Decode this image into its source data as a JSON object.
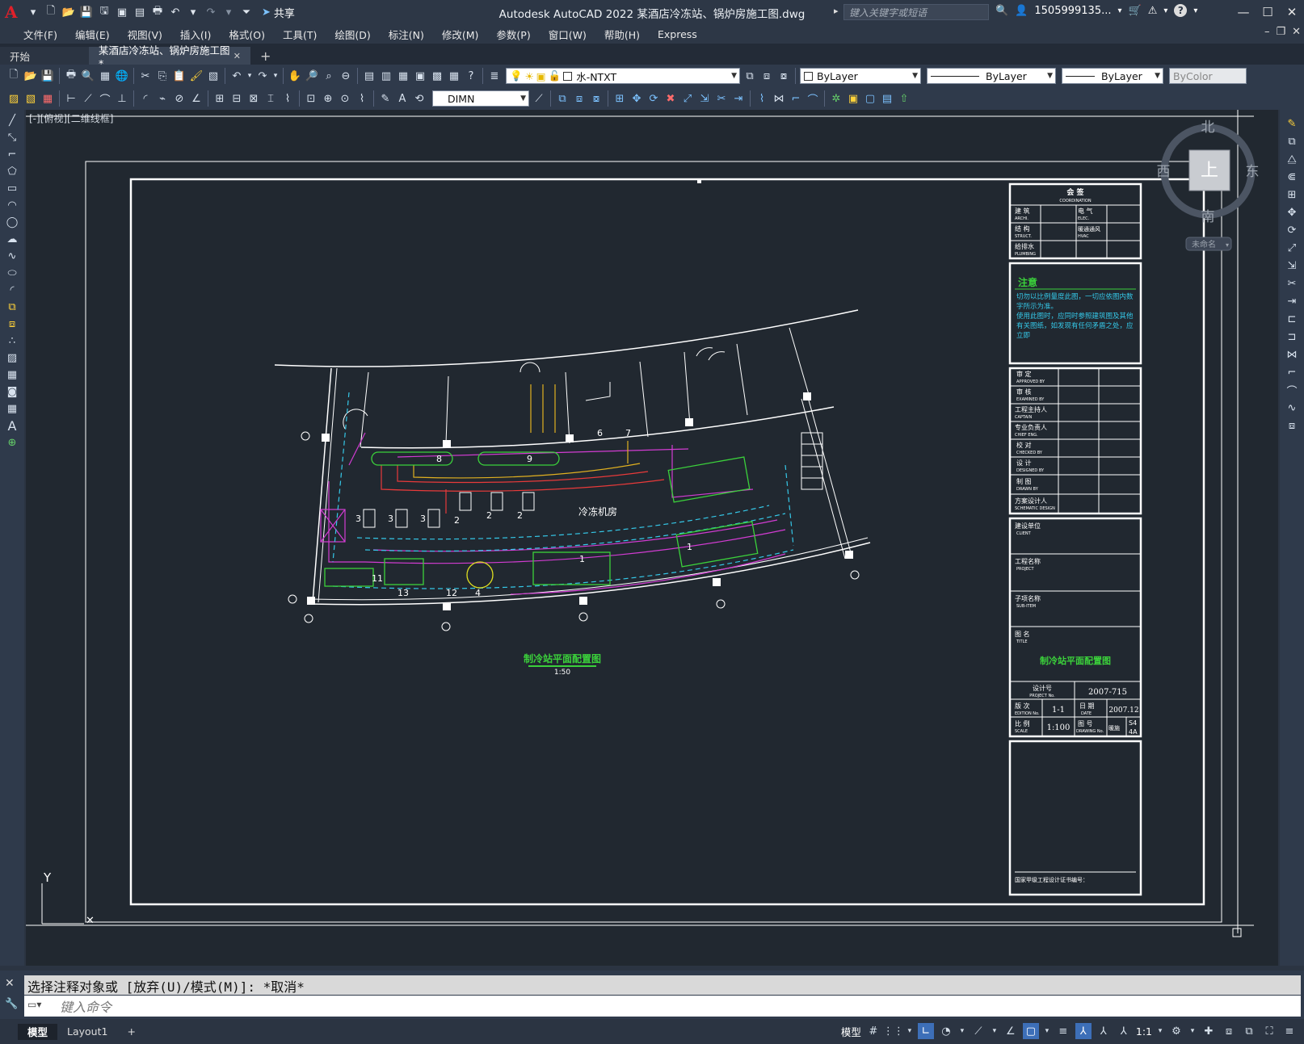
{
  "app": {
    "logo": "A",
    "window_title": "Autodesk AutoCAD 2022    某酒店冷冻站、锅炉房施工图.dwg",
    "share_label": "共享",
    "search_placeholder": "键入关键字或短语",
    "user": "1505999135...",
    "help": "?"
  },
  "menu": [
    "文件(F)",
    "编辑(E)",
    "视图(V)",
    "插入(I)",
    "格式(O)",
    "工具(T)",
    "绘图(D)",
    "标注(N)",
    "修改(M)",
    "参数(P)",
    "窗口(W)",
    "帮助(H)",
    "Express"
  ],
  "tabs": {
    "start": "开始",
    "active": "某酒店冷冻站、锅炉房施工图*",
    "close": "✕",
    "add": "+"
  },
  "toolbar": {
    "layer": "水-NTXT",
    "color": "ByLayer",
    "linetype": "ByLayer",
    "lineweight": "ByLayer",
    "plotstyle": "ByColor",
    "dimstyle": "DIMN"
  },
  "viewport": {
    "label": "[-][俯视][二维线框]"
  },
  "viewcube": {
    "north": "北",
    "south": "南",
    "east": "东",
    "west": "西",
    "top": "上",
    "wcs": "未命名"
  },
  "ucs": {
    "y": "Y"
  },
  "drawing": {
    "plan_title": "制冷站平面配置图",
    "plan_scale": "1:50",
    "room_label": "冷冻机房",
    "title_block": {
      "coordination": "会 签",
      "coordination_en": "COORDINATION",
      "arch": "建 筑",
      "arch_en": "ARCHI.",
      "elec": "电 气",
      "elec_en": "ELEC.",
      "struct": "结 构",
      "struct_en": "STRUCT.",
      "hvac": "暖通通风",
      "hvac_en": "HVAC",
      "plumb": "给排水",
      "plumb_en": "PLUMBING",
      "notes_title": "注意",
      "notes_1": "切勿以比例量度此图，一切应依图内数字所示为准。",
      "notes_2": "使用此图时，应同时参照建筑图及其他有关图纸，如发现有任何矛盾之处，应立即",
      "approved": "审 定",
      "approved_en": "APPROVED BY",
      "examined": "审 核",
      "examined_en": "EXAMINED BY",
      "captain": "工程主持人",
      "captain_en": "CAPTAIN",
      "chief": "专业负责人",
      "chief_en": "CHIEF ENG.",
      "checked": "校 对",
      "checked_en": "CHECKED BY",
      "designed": "设 计",
      "designed_en": "DESIGNED BY",
      "drawn": "制 图",
      "drawn_en": "DRAWN BY",
      "scheme": "方案设计人",
      "scheme_en": "SCHEMATIC DESIGN",
      "client": "建设单位",
      "client_en": "CLIENT",
      "project": "工程名称",
      "project_en": "PROJECT",
      "subitem": "子项名称",
      "subitem_en": "SUB-ITEM",
      "titlelbl": "图 名",
      "titlelbl_en": "TITLE",
      "title": "制冷站平面配置图",
      "projno_lbl": "设计号",
      "projno_en": "PROJECT No.",
      "projno": "2007-715",
      "edition_lbl": "版 次",
      "edition_en": "EDITION No.",
      "edition": "1-1",
      "date_lbl": "日 期",
      "date_en": "DATE",
      "date": "2007.12",
      "scale_lbl": "比 例",
      "scale_en": "SCALE",
      "scale": "1:100",
      "dwgno_lbl": "图 号",
      "dwgno_en": "DRAWING No.",
      "sheet_lbl": "暖施",
      "sheet": "S4",
      "sheet2": "4A",
      "cert": "国家甲级工程设计证书编号："
    }
  },
  "command": {
    "history": "选择注释对象或 [放弃(U)/模式(M)]: *取消*",
    "placeholder": "键入命令"
  },
  "status": {
    "model_tab": "模型",
    "layout_tab": "Layout1",
    "add": "+",
    "model": "模型",
    "scale": "1:1"
  }
}
